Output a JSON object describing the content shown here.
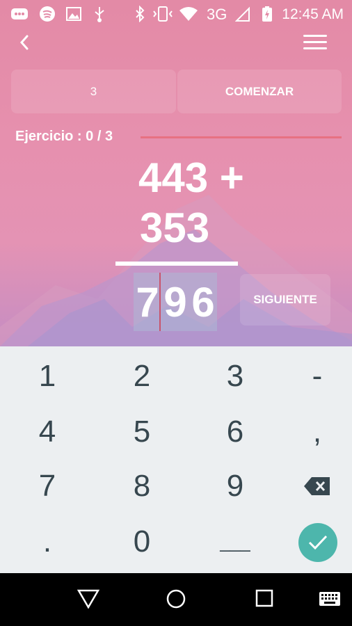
{
  "status_bar": {
    "time": "12:45 AM",
    "network": "3G",
    "icons": [
      "message-icon",
      "spotify-icon",
      "image-icon",
      "usb-icon",
      "bluetooth-icon",
      "vibrate-icon",
      "wifi-icon",
      "signal-icon",
      "battery-charging-icon"
    ]
  },
  "toolbar": {
    "back_icon": "chevron-left-icon",
    "menu_icon": "hamburger-menu-icon"
  },
  "controls": {
    "count_value": "3",
    "start_label": "COMENZAR"
  },
  "exercise": {
    "progress_text": "Ejercicio : 0 / 3"
  },
  "problem": {
    "operand1": "443 +",
    "operand2": "353"
  },
  "answer": {
    "digits": [
      "7",
      "9",
      "6"
    ]
  },
  "next_label": "SIGUIENTE",
  "keyboard": {
    "row1": [
      "1",
      "2",
      "3",
      "-"
    ],
    "row2": [
      "4",
      "5",
      "6",
      ","
    ],
    "row3": [
      "7",
      "8",
      "9"
    ],
    "row4": [
      ".",
      "0",
      "___"
    ],
    "backspace_icon": "backspace-icon",
    "done_icon": "check-icon"
  },
  "nav_bar": {
    "icons": [
      "back-triangle-icon",
      "home-circle-icon",
      "recents-square-icon",
      "keyboard-icon"
    ]
  },
  "colors": {
    "accent": "#4db6ac",
    "progress_line": "#e77182",
    "caret": "#c9546c"
  }
}
